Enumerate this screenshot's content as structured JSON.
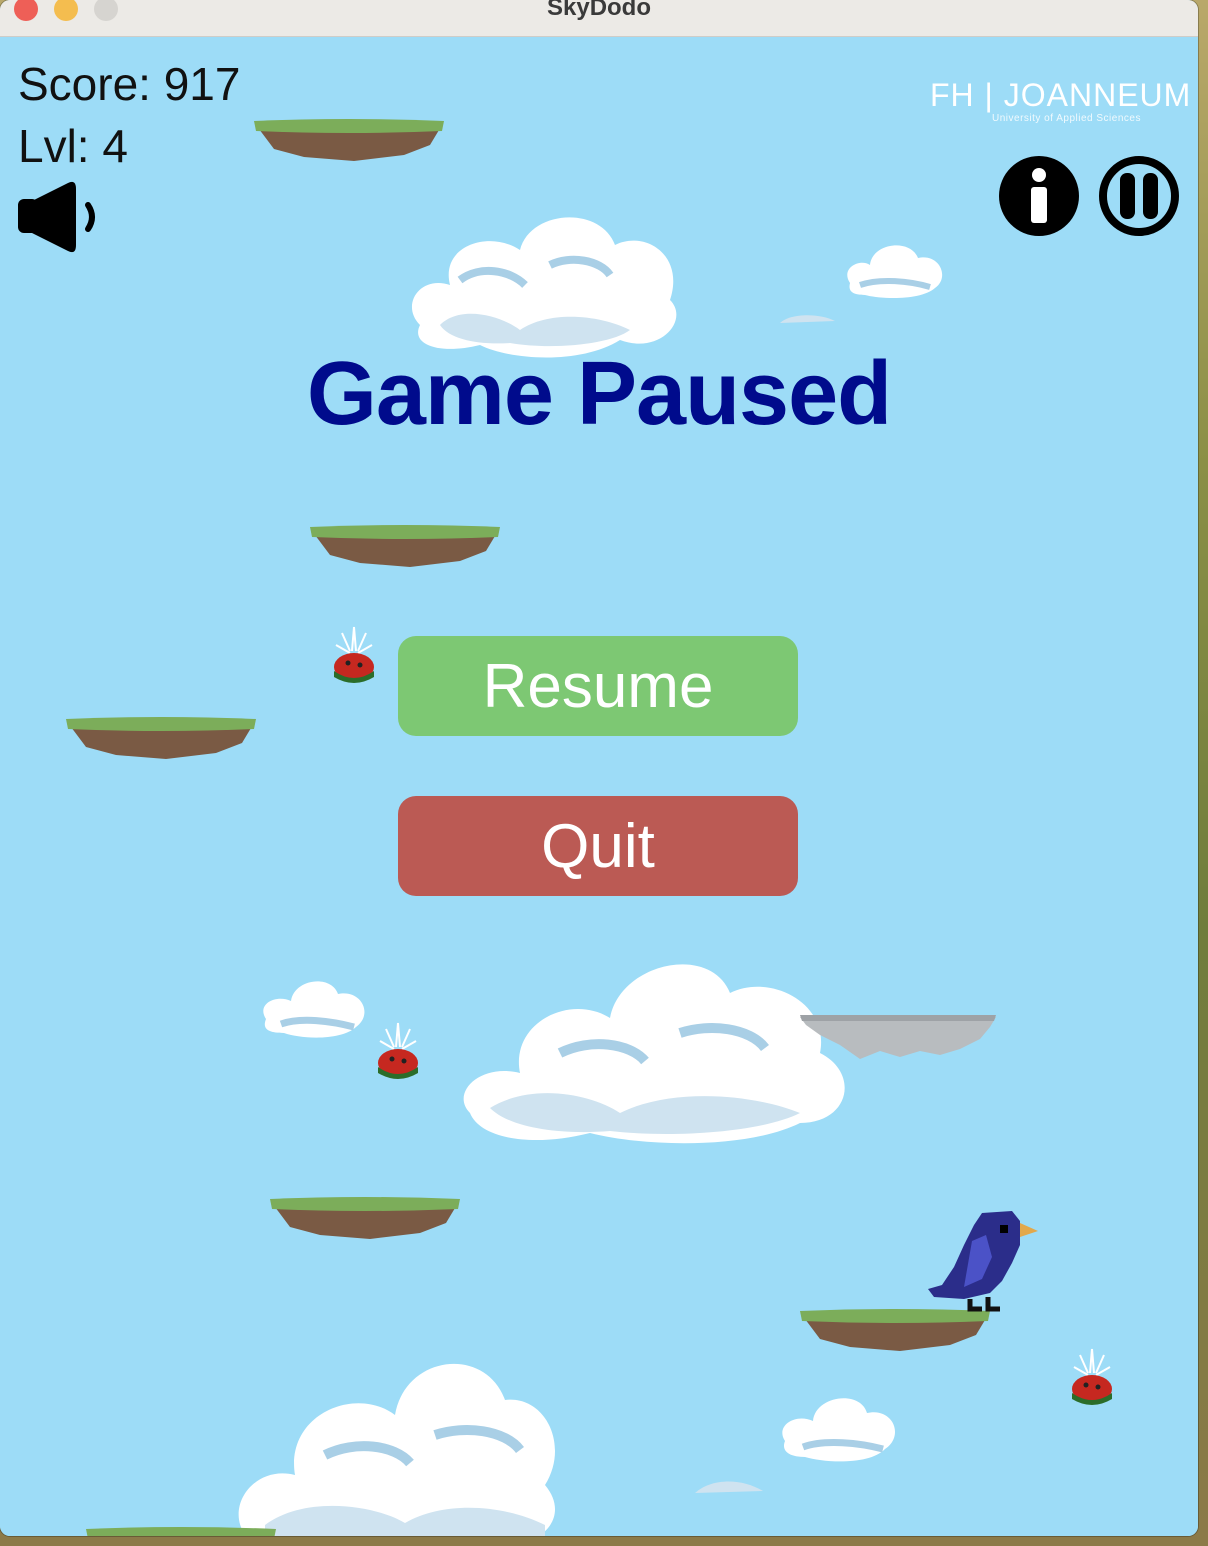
{
  "window": {
    "title": "SkyDodo"
  },
  "hud": {
    "score_text": "Score: 917",
    "level_text": "Lvl: 4",
    "sound_icon": "speaker-icon",
    "info_icon": "info-icon",
    "pause_icon": "pause-icon"
  },
  "logo": {
    "main": "FH | JOANNEUM",
    "sub": "University of Applied Sciences"
  },
  "pause_menu": {
    "title": "Game Paused",
    "resume_label": "Resume",
    "quit_label": "Quit"
  },
  "colors": {
    "sky": "#9ddcf7",
    "title": "#000b8c",
    "resume": "#7dc873",
    "quit": "#bb5a54",
    "grass": "#7cad5a",
    "dirt": "#7a5a44",
    "bird": "#2b2d8a",
    "beak": "#e2a84b"
  }
}
